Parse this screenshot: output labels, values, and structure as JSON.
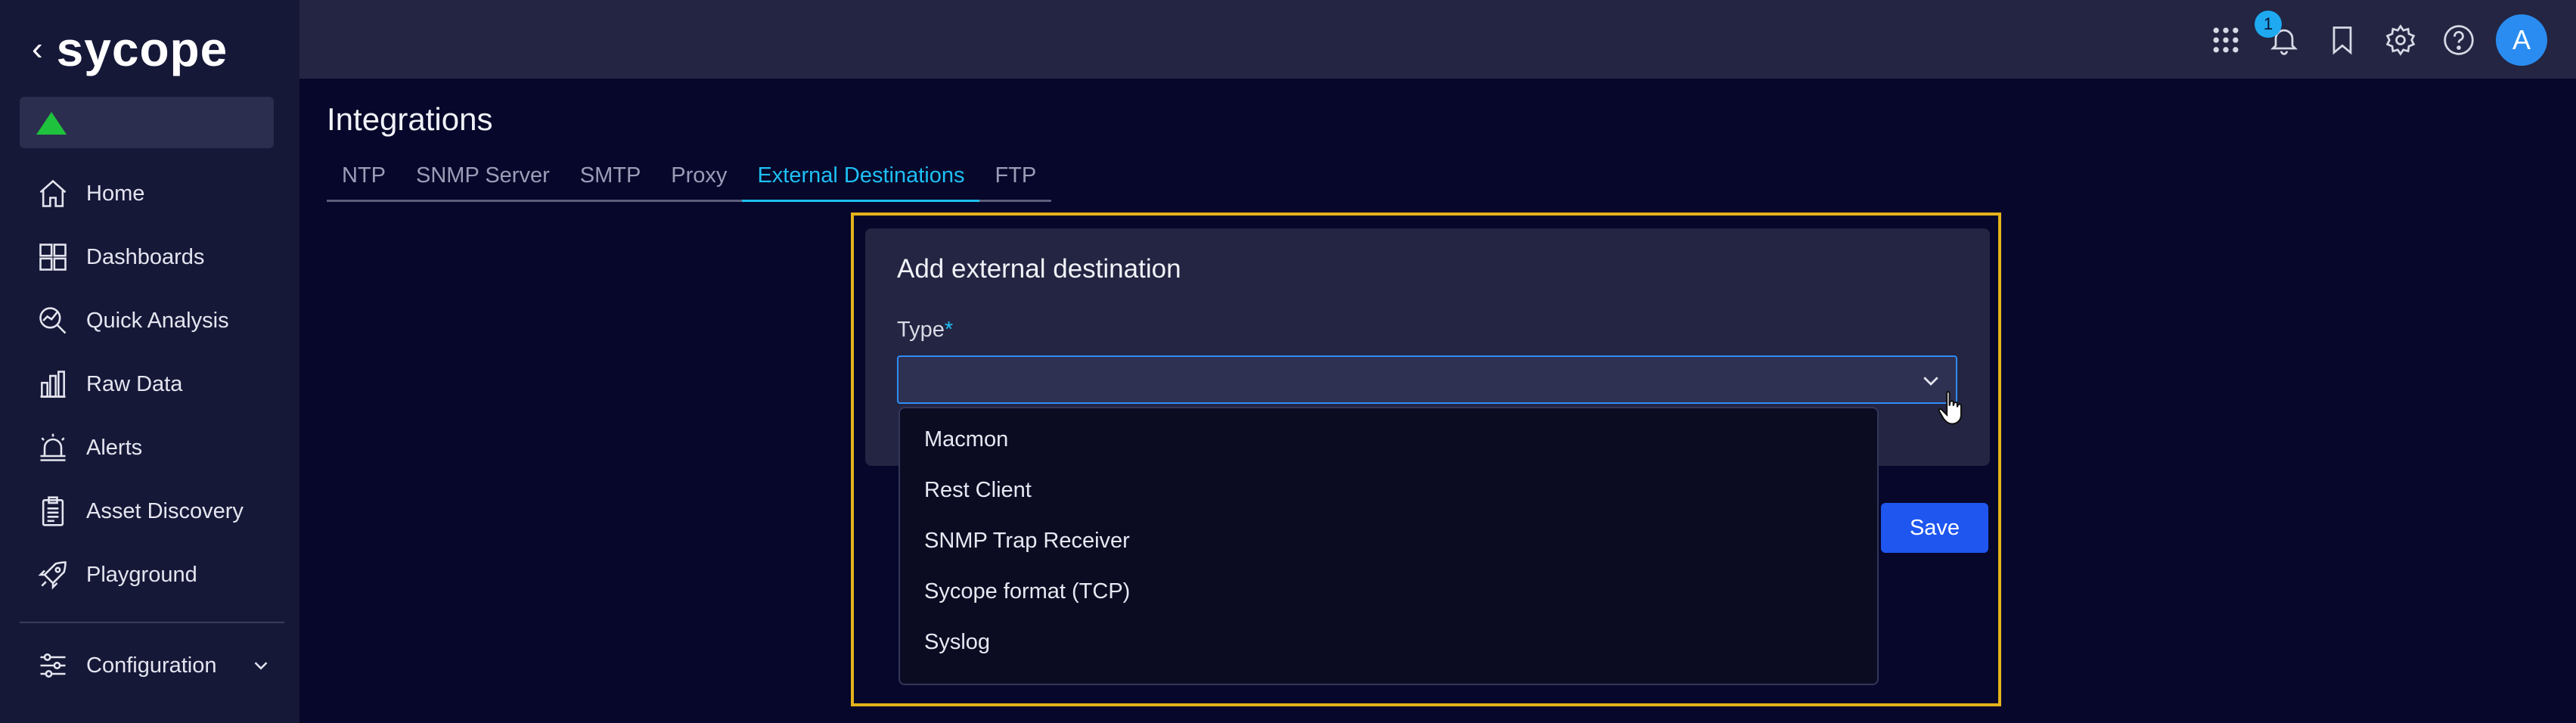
{
  "sidebar": {
    "back_glyph": "‹",
    "logo_text": "sycope",
    "status": {
      "icon": "status-up-icon",
      "color": "#1fc23c"
    },
    "items": [
      {
        "label": "Home",
        "icon": "home-icon"
      },
      {
        "label": "Dashboards",
        "icon": "dashboards-icon"
      },
      {
        "label": "Quick Analysis",
        "icon": "quick-analysis-icon"
      },
      {
        "label": "Raw Data",
        "icon": "raw-data-icon"
      },
      {
        "label": "Alerts",
        "icon": "alerts-icon"
      },
      {
        "label": "Asset Discovery",
        "icon": "asset-discovery-icon"
      },
      {
        "label": "Playground",
        "icon": "playground-icon"
      }
    ],
    "configuration": {
      "label": "Configuration",
      "icon": "configuration-icon"
    }
  },
  "topbar": {
    "icons": [
      "apps-grid-icon",
      "bell-icon",
      "bookmark-icon",
      "gear-icon",
      "help-icon"
    ],
    "notification_count": "1",
    "avatar_initial": "A"
  },
  "page": {
    "title": "Integrations",
    "tabs": [
      {
        "label": "NTP",
        "active": false
      },
      {
        "label": "SNMP Server",
        "active": false
      },
      {
        "label": "SMTP",
        "active": false
      },
      {
        "label": "Proxy",
        "active": false
      },
      {
        "label": "External Destinations",
        "active": true
      },
      {
        "label": "FTP",
        "active": false
      }
    ]
  },
  "form": {
    "title": "Add external destination",
    "type_label": "Type",
    "required_mark": "*",
    "type_value": "",
    "options": [
      "Macmon",
      "Rest Client",
      "SNMP Trap Receiver",
      "Sycope format (TCP)",
      "Syslog"
    ],
    "save_label": "Save"
  },
  "colors": {
    "accent": "#1ec0f4",
    "primary_button": "#1f56f0",
    "highlight_frame": "#e5b21a",
    "background": "#06072a"
  }
}
